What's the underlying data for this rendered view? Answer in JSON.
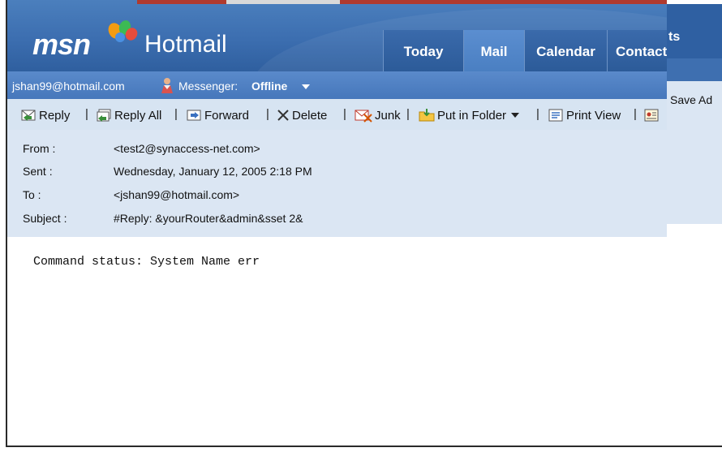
{
  "header": {
    "brand": "msn",
    "product": "Hotmail",
    "tabs": [
      {
        "label": "Today",
        "active": false
      },
      {
        "label": "Mail",
        "active": true
      },
      {
        "label": "Calendar",
        "active": false
      },
      {
        "label": "Contact",
        "active": false
      }
    ],
    "clipped_tab_fragment": "ts",
    "colors": {
      "header_blue": "#3c6eb0",
      "active_tab": "#4a7fc2",
      "panel_light": "#dbe6f3"
    }
  },
  "userbar": {
    "email": "jshan99@hotmail.com",
    "messenger_label": "Messenger:",
    "messenger_status": "Offline",
    "icons": [
      "messenger-buddy-icon",
      "chevron-down-icon"
    ]
  },
  "toolbar": {
    "reply": "Reply",
    "reply_all": "Reply All",
    "forward": "Forward",
    "delete": "Delete",
    "junk": "Junk",
    "put_in_folder": "Put in Folder",
    "print_view": "Print View",
    "separator": "|",
    "save_address_clipped": "Save Ad"
  },
  "message": {
    "from_label": "From :",
    "from_value": "<test2@synaccess-net.com>",
    "sent_label": "Sent :",
    "sent_value": "Wednesday, January 12, 2005 2:18 PM",
    "to_label": "To :",
    "to_value": "<jshan99@hotmail.com>",
    "subject_label": "Subject :",
    "subject_value": "#Reply: &yourRouter&admin&sset 2&",
    "body": "Command status: System Name err"
  }
}
